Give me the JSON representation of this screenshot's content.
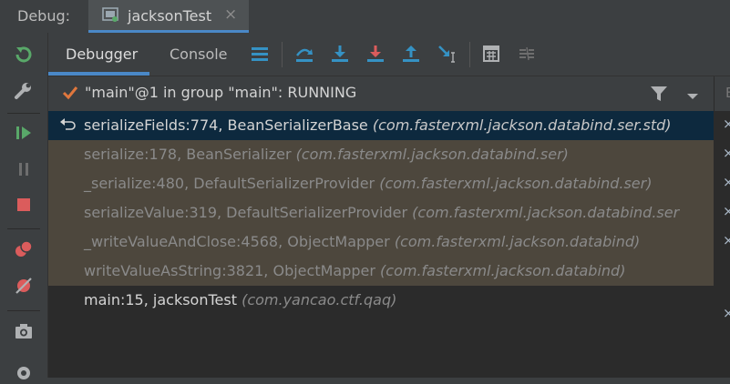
{
  "title_bar": {
    "debug_label": "Debug:",
    "run_tab_label": "jacksonTest",
    "close_glyph": "×"
  },
  "tabs": {
    "debugger": "Debugger",
    "console": "Console"
  },
  "thread": {
    "status_text": "\"main\"@1 in group \"main\": RUNNING"
  },
  "frames": [
    {
      "method": "serializeFields:774, BeanSerializerBase",
      "package": "(com.fasterxml.jackson.databind.ser.std)"
    },
    {
      "method": "serialize:178, BeanSerializer",
      "package": "(com.fasterxml.jackson.databind.ser)"
    },
    {
      "method": "_serialize:480, DefaultSerializerProvider",
      "package": "(com.fasterxml.jackson.databind.ser)"
    },
    {
      "method": "serializeValue:319, DefaultSerializerProvider",
      "package": "(com.fasterxml.jackson.databind.ser"
    },
    {
      "method": "_writeValueAndClose:4568, ObjectMapper",
      "package": "(com.fasterxml.jackson.databind)"
    },
    {
      "method": "writeValueAsString:3821, ObjectMapper",
      "package": "(com.fasterxml.jackson.databind)"
    },
    {
      "method": "main:15, jacksonTest",
      "package": "(com.yancao.ctf.qaq)"
    }
  ],
  "right_panel": {
    "header_glyph": "E",
    "close_glyph": "×"
  },
  "icons": {
    "left_toolbar": [
      "rerun-icon",
      "wrench-icon",
      "resume-icon",
      "pause-icon",
      "stop-icon",
      "view-breakpoints-icon",
      "mute-breakpoints-icon",
      "camera-icon",
      "settings-icon"
    ],
    "step_toolbar": [
      "layout-icon",
      "step-over-icon",
      "step-into-icon",
      "force-step-into-icon",
      "step-out-icon",
      "run-to-cursor-icon",
      "evaluate-expression-icon",
      "trace-icon"
    ]
  },
  "colors": {
    "accent": "#4a88c7",
    "selected_frame": "#0d293e",
    "library_frame": "#4d473d",
    "green": "#59a869",
    "red": "#db5c5c"
  }
}
